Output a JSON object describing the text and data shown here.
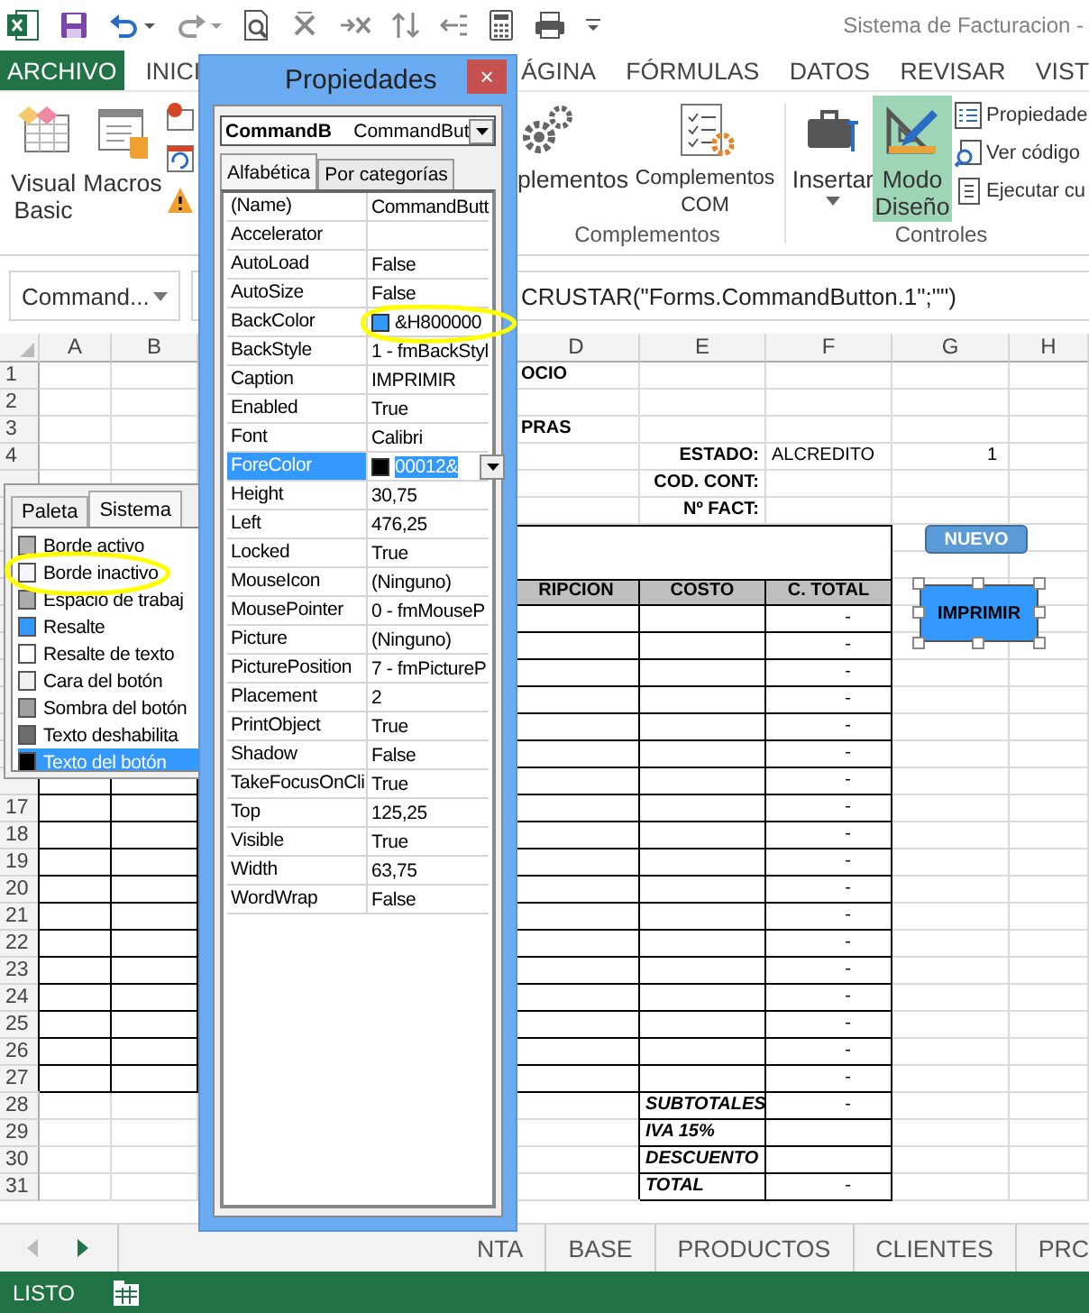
{
  "title_bar": {
    "title": "Sistema de Facturacion -"
  },
  "ribbon_tabs": [
    {
      "label": "ARCHIVO",
      "kind": "file"
    },
    {
      "label": "INICI",
      "kind": "tab"
    },
    {
      "label": "ÁGINA",
      "kind": "tab"
    },
    {
      "label": "FÓRMULAS",
      "kind": "tab"
    },
    {
      "label": "DATOS",
      "kind": "tab"
    },
    {
      "label": "REVISAR",
      "kind": "tab"
    },
    {
      "label": "VIST",
      "kind": "tab"
    }
  ],
  "ribbon": {
    "code_buttons": [
      {
        "label": "Visual Basic"
      },
      {
        "label": "Macros"
      }
    ],
    "complementos": {
      "buttons": [
        {
          "label": "plementos"
        },
        {
          "label": "Complementos COM"
        }
      ],
      "group_label": "Complementos"
    },
    "controles": {
      "buttons": [
        {
          "label": "Insertar",
          "on": false
        },
        {
          "label": "Modo Diseño",
          "on": true
        }
      ],
      "small_buttons": [
        {
          "label": "Propiedade"
        },
        {
          "label": "Ver código"
        },
        {
          "label": "Ejecutar cu"
        }
      ],
      "group_label": "Controles"
    }
  },
  "formula_bar": {
    "name_box": "Command...",
    "formula": "CRUSTAR(\"Forms.CommandButton.1\";\"\")"
  },
  "sheet": {
    "columns": [
      "A",
      "B",
      "D",
      "E",
      "F",
      "G",
      "H"
    ],
    "rows": [
      {
        "number": "1",
        "cells": [
          "",
          "",
          {
            "text": "OCIO",
            "kind": "title"
          }
        ]
      },
      {
        "number": "2",
        "cells": []
      },
      {
        "number": "3",
        "cells": [
          "",
          "",
          {
            "text": "PRAS",
            "kind": "title"
          }
        ]
      },
      {
        "number": "4",
        "cells": [
          "",
          "",
          "",
          {
            "text": "ESTADO:",
            "kind": "label"
          },
          {
            "text": "ALCREDITO",
            "kind": "value"
          },
          {
            "text": "1",
            "kind": "number"
          }
        ]
      },
      {
        "cells": [
          "",
          "",
          "",
          {
            "text": "COD. CONT:",
            "kind": "label"
          }
        ]
      },
      {
        "cells": [
          "",
          "",
          "",
          {
            "text": "Nº FACT:",
            "kind": "label"
          }
        ]
      },
      {
        "cells": []
      },
      {
        "cells": []
      },
      {
        "cells": [
          "",
          "",
          {
            "text": "RIPCION",
            "kind": "header"
          },
          {
            "text": "COSTO",
            "kind": "header"
          },
          {
            "text": "C. TOTAL",
            "kind": "header"
          }
        ]
      },
      {
        "cells": [
          "",
          "",
          {
            "kind": "boxed"
          },
          {
            "kind": "boxed"
          },
          {
            "text": "-",
            "kind": "amount"
          }
        ]
      },
      {
        "cells": [
          "",
          "",
          {
            "kind": "boxed"
          },
          {
            "kind": "boxed"
          },
          {
            "text": "-",
            "kind": "amount"
          }
        ]
      },
      {
        "cells": [
          "",
          "",
          {
            "kind": "boxed"
          },
          {
            "kind": "boxed"
          },
          {
            "text": "-",
            "kind": "amount"
          }
        ]
      },
      {
        "cells": [
          "",
          "",
          {
            "kind": "boxed"
          },
          {
            "kind": "boxed"
          },
          {
            "text": "-",
            "kind": "amount"
          }
        ]
      },
      {
        "cells": [
          "",
          "",
          {
            "kind": "boxed"
          },
          {
            "kind": "boxed"
          },
          {
            "text": "-",
            "kind": "amount"
          }
        ]
      },
      {
        "cells": [
          "",
          "",
          {
            "kind": "boxed"
          },
          {
            "kind": "boxed"
          },
          {
            "text": "-",
            "kind": "amount"
          }
        ]
      },
      {
        "cells": [
          {
            "kind": "boxed"
          },
          {
            "kind": "boxed"
          },
          {
            "kind": "boxed"
          },
          {
            "kind": "boxed"
          },
          {
            "text": "-",
            "kind": "amount"
          }
        ]
      },
      {
        "number": "17",
        "cells": [
          {
            "kind": "boxed"
          },
          {
            "kind": "boxed"
          },
          {
            "kind": "boxed"
          },
          {
            "kind": "boxed"
          },
          {
            "text": "-",
            "kind": "amount"
          }
        ]
      },
      {
        "number": "18",
        "cells": [
          {
            "kind": "boxed"
          },
          {
            "kind": "boxed"
          },
          {
            "kind": "boxed"
          },
          {
            "kind": "boxed"
          },
          {
            "text": "-",
            "kind": "amount"
          }
        ]
      },
      {
        "number": "19",
        "cells": [
          {
            "kind": "boxed"
          },
          {
            "kind": "boxed"
          },
          {
            "kind": "boxed"
          },
          {
            "kind": "boxed"
          },
          {
            "text": "-",
            "kind": "amount"
          }
        ]
      },
      {
        "number": "20",
        "cells": [
          {
            "kind": "boxed"
          },
          {
            "kind": "boxed"
          },
          {
            "kind": "boxed"
          },
          {
            "kind": "boxed"
          },
          {
            "text": "-",
            "kind": "amount"
          }
        ]
      },
      {
        "number": "21",
        "cells": [
          {
            "kind": "boxed"
          },
          {
            "kind": "boxed"
          },
          {
            "kind": "boxed"
          },
          {
            "kind": "boxed"
          },
          {
            "text": "-",
            "kind": "amount"
          }
        ]
      },
      {
        "number": "22",
        "cells": [
          {
            "kind": "boxed"
          },
          {
            "kind": "boxed"
          },
          {
            "kind": "boxed"
          },
          {
            "kind": "boxed"
          },
          {
            "text": "-",
            "kind": "amount"
          }
        ]
      },
      {
        "number": "23",
        "cells": [
          {
            "kind": "boxed"
          },
          {
            "kind": "boxed"
          },
          {
            "kind": "boxed"
          },
          {
            "kind": "boxed"
          },
          {
            "text": "-",
            "kind": "amount"
          }
        ]
      },
      {
        "number": "24",
        "cells": [
          {
            "kind": "boxed"
          },
          {
            "kind": "boxed"
          },
          {
            "kind": "boxed"
          },
          {
            "kind": "boxed"
          },
          {
            "text": "-",
            "kind": "amount"
          }
        ]
      },
      {
        "number": "25",
        "cells": [
          {
            "kind": "boxed"
          },
          {
            "kind": "boxed"
          },
          {
            "kind": "boxed"
          },
          {
            "kind": "boxed"
          },
          {
            "text": "-",
            "kind": "amount"
          }
        ]
      },
      {
        "number": "26",
        "cells": [
          {
            "kind": "boxed"
          },
          {
            "kind": "boxed"
          },
          {
            "kind": "boxed"
          },
          {
            "kind": "boxed"
          },
          {
            "text": "-",
            "kind": "amount"
          }
        ]
      },
      {
        "number": "27",
        "cells": [
          {
            "kind": "boxed"
          },
          {
            "kind": "boxed"
          },
          {
            "kind": "boxed"
          },
          {
            "kind": "boxed"
          },
          {
            "text": "-",
            "kind": "amount"
          }
        ]
      },
      {
        "number": "28",
        "cells": [
          "",
          "",
          "",
          {
            "text": "SUBTOTALES",
            "kind": "total-label"
          },
          {
            "text": "-",
            "kind": "amount"
          }
        ]
      },
      {
        "number": "29",
        "cells": [
          "",
          "",
          "",
          {
            "text": "IVA 15%",
            "kind": "total-label"
          },
          {
            "kind": "boxed"
          }
        ]
      },
      {
        "number": "30",
        "cells": [
          "",
          "",
          "",
          {
            "text": "DESCUENTO",
            "kind": "total-label"
          },
          {
            "kind": "boxed"
          }
        ]
      },
      {
        "number": "31",
        "cells": [
          "",
          "",
          "",
          {
            "text": "TOTAL",
            "kind": "total-label"
          },
          {
            "text": "-",
            "kind": "amount"
          }
        ]
      }
    ],
    "buttons": [
      {
        "label": "NUEVO",
        "selected": false
      },
      {
        "label": "IMPRIMIR",
        "selected": true
      }
    ]
  },
  "sheet_tabs": [
    {
      "label": "NTA",
      "selected": false
    },
    {
      "label": "BASE",
      "selected": false
    },
    {
      "label": "PRODUCTOS",
      "selected": false
    },
    {
      "label": "CLIENTES",
      "selected": false
    },
    {
      "label": "PRC",
      "selected": false
    }
  ],
  "status_bar": {
    "text": "LISTO"
  },
  "color_dropdown": {
    "tabs": [
      {
        "label": "Paleta",
        "selected": false
      },
      {
        "label": "Sistema",
        "selected": true
      }
    ],
    "items": [
      {
        "label": "Borde activo",
        "color": "#b4b4b4",
        "selected": false
      },
      {
        "label": "Borde inactivo",
        "color": "#f4f7fc",
        "selected": false
      },
      {
        "label": "Espacio de trabaj",
        "color": "#ababab",
        "selected": false
      },
      {
        "label": "Resalte",
        "color": "#3399ff",
        "selected": false
      },
      {
        "label": "Resalte de texto",
        "color": "#ffffff",
        "selected": false
      },
      {
        "label": "Cara del botón",
        "color": "#f0f0f0",
        "selected": false
      },
      {
        "label": "Sombra del botón",
        "color": "#a0a0a0",
        "selected": false
      },
      {
        "label": "Texto deshabilita",
        "color": "#6d6d6d",
        "selected": false
      },
      {
        "label": "Texto del botón",
        "color": "#000000",
        "selected": true
      }
    ]
  },
  "properties_window": {
    "title": "Propiedades",
    "close": "×",
    "object_name": "CommandB",
    "object_type": "CommandBut",
    "tabs": [
      {
        "label": "Alfabética",
        "selected": true
      },
      {
        "label": "Por categorías",
        "selected": false
      }
    ],
    "properties": [
      {
        "name": "(Name)",
        "value": "CommandButt",
        "selected": false
      },
      {
        "name": "Accelerator",
        "selected": false
      },
      {
        "name": "AutoLoad",
        "value": "False",
        "selected": false
      },
      {
        "name": "AutoSize",
        "value": "False",
        "selected": false
      },
      {
        "name": "BackColor",
        "value": "&H800000",
        "color": "#3399ff",
        "selected": false
      },
      {
        "name": "BackStyle",
        "value": "1 - fmBackStyl",
        "selected": false
      },
      {
        "name": "Caption",
        "value": "IMPRIMIR",
        "selected": false
      },
      {
        "name": "Enabled",
        "value": "True",
        "selected": false
      },
      {
        "name": "Font",
        "value": "Calibri",
        "selected": false
      },
      {
        "name": "ForeColor",
        "value": "00012&",
        "color": "#000000",
        "selected": true
      },
      {
        "name": "Height",
        "value": "30,75",
        "selected": false
      },
      {
        "name": "Left",
        "value": "476,25",
        "selected": false
      },
      {
        "name": "Locked",
        "value": "True",
        "selected": false
      },
      {
        "name": "MouseIcon",
        "value": "(Ninguno)",
        "selected": false
      },
      {
        "name": "MousePointer",
        "value": "0 - fmMouseP",
        "selected": false
      },
      {
        "name": "Picture",
        "value": "(Ninguno)",
        "selected": false
      },
      {
        "name": "PicturePosition",
        "value": "7 - fmPictureP",
        "selected": false
      },
      {
        "name": "Placement",
        "value": "2",
        "selected": false
      },
      {
        "name": "PrintObject",
        "value": "True",
        "selected": false
      },
      {
        "name": "Shadow",
        "value": "False",
        "selected": false
      },
      {
        "name": "TakeFocusOnCli",
        "value": "True",
        "selected": false
      },
      {
        "name": "Top",
        "value": "125,25",
        "selected": false
      },
      {
        "name": "Visible",
        "value": "True",
        "selected": false
      },
      {
        "name": "Width",
        "value": "63,75",
        "selected": false
      },
      {
        "name": "WordWrap",
        "value": "False",
        "selected": false
      }
    ]
  }
}
